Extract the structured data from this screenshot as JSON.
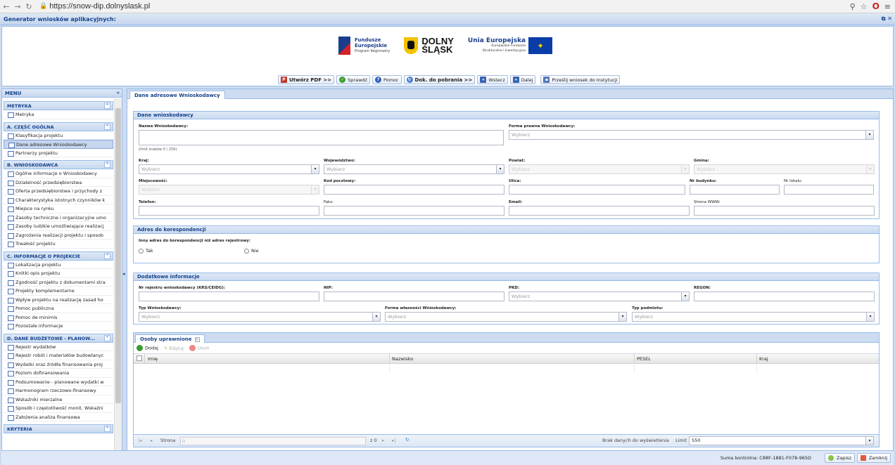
{
  "browser": {
    "url": "https://snow-dip.dolnyslask.pl"
  },
  "app": {
    "title": "Generator wniosków aplikacyjnych:"
  },
  "logos": {
    "fe_line1": "Fundusze",
    "fe_line2": "Europejskie",
    "fe_line3": "Program Regionalny",
    "ds_line1": "DOLNY",
    "ds_line2": "ŚLĄSK",
    "ue_line1": "Unia Europejska",
    "ue_line2": "Europejskie Fundusze",
    "ue_line3": "Strukturalne i Inwestycyjne"
  },
  "toolbar": {
    "pdf": "Utwórz PDF >>",
    "check": "Sprawdź",
    "help": "Pomoc",
    "docs": "Dok. do pobrania >>",
    "back": "Wstecz",
    "next": "Dalej",
    "send": "Prześlij wniosek do Instytucji"
  },
  "menu": {
    "title": "MENU",
    "sections": [
      {
        "title": "METRYKA",
        "items": [
          "Metryka"
        ]
      },
      {
        "title": "A. CZĘŚĆ OGÓLNA",
        "items": [
          "Klasyfikacja projektu",
          "Dane adresowe Wnioskodawcy",
          "Partnerzy projektu"
        ]
      },
      {
        "title": "B. WNIOSKODAWCA",
        "items": [
          "Ogólne informacje o Wnioskodawcy",
          "Działalność przedsiębiorstwa",
          "Oferta przedsiębiorstwa i przychody z",
          "Charakterystyka istotnych czynników k",
          "Miejsce na rynku",
          "Zasoby techniczne i organizacyjne umo",
          "Zasoby ludzkie umożliwiające realizacj",
          "Zagrożenia realizacji projektu i sposob",
          "Trwałość projektu"
        ]
      },
      {
        "title": "C. INFORMACJE O PROJEKCIE",
        "items": [
          "Lokalizacja projektu",
          "Krótki opis projektu",
          "Zgodność projektu z dokumentami stra",
          "Projekty komplementarne",
          "Wpływ projektu na realizację zasad ho",
          "Pomoc publiczna",
          "Pomoc de minimis",
          "Pozostałe informacje"
        ]
      },
      {
        "title": "D. DANE BUDŻETOWE - PLANOW...",
        "items": [
          "Rejestr wydatków",
          "Rejestr robót i materiałów budowlanyc",
          "Wydatki oraz źródła finansowania proj",
          "Poziom dofinansowania",
          "Podsumowanie - planowane wydatki w",
          "Harmonogram rzeczowo-finansowy",
          "Wskaźniki mierzalne",
          "Sposób i częstotliwość monit. Wskaźni",
          "Założenia analiza finansowa"
        ]
      },
      {
        "title": "KRYTERIA",
        "items": []
      }
    ]
  },
  "main": {
    "tab": "Dane adresowe Wnioskodawcy",
    "dane": {
      "title": "Dane wnioskodawcy",
      "nazwa": "Nazwa Wnioskodawcy:",
      "forma": "Forma prawna Wnioskodawcy:",
      "limit": "(limit znaków 0 / 250)",
      "kraj": "Kraj:",
      "woj": "Województwo:",
      "powiat": "Powiat:",
      "gmina": "Gmina:",
      "miejsc": "Miejscowość:",
      "kod": "Kod pocztowy:",
      "ulica": "Ulica:",
      "nrbud": "Nr budynku:",
      "nrlok": "Nr lokalu:",
      "tel": "Telefon:",
      "faks": "Faks:",
      "email": "Email:",
      "www": "Strona WWW:"
    },
    "adres": {
      "title": "Adres do korespondencji",
      "question": "Inny adres do korespondencji niż adres rejestrowy:",
      "tak": "Tak",
      "nie": "Nie"
    },
    "dodatkowe": {
      "title": "Dodatkowe informacje",
      "krs": "Nr rejestru wnioskodawcy (KRS/CEIDG):",
      "nip": "NIP:",
      "pkd": "PKD:",
      "regon": "REGON:",
      "typ": "Typ Wnioskodawcy:",
      "wlasn": "Forma własności Wnioskodawcy:",
      "podm": "Typ podmiotu:"
    },
    "placeholder": "Wybierz",
    "osoby": {
      "tab": "Osoby uprawnione",
      "add": "Dodaj",
      "edit": "Edytuj",
      "del": "Usuń",
      "cols": [
        "Imię",
        "Nazwisko",
        "PESEL",
        "Kraj"
      ],
      "page_label": "Strona",
      "page_value": "0",
      "of": "z 0",
      "empty": "Brak danych do wyświetlenia",
      "limit_label": "Limit",
      "limit_value": "550"
    }
  },
  "footer": {
    "checksum": "Suma kontrolna: C88F-1881-F078-965D",
    "save": "Zapisz",
    "close": "Zamknij"
  }
}
